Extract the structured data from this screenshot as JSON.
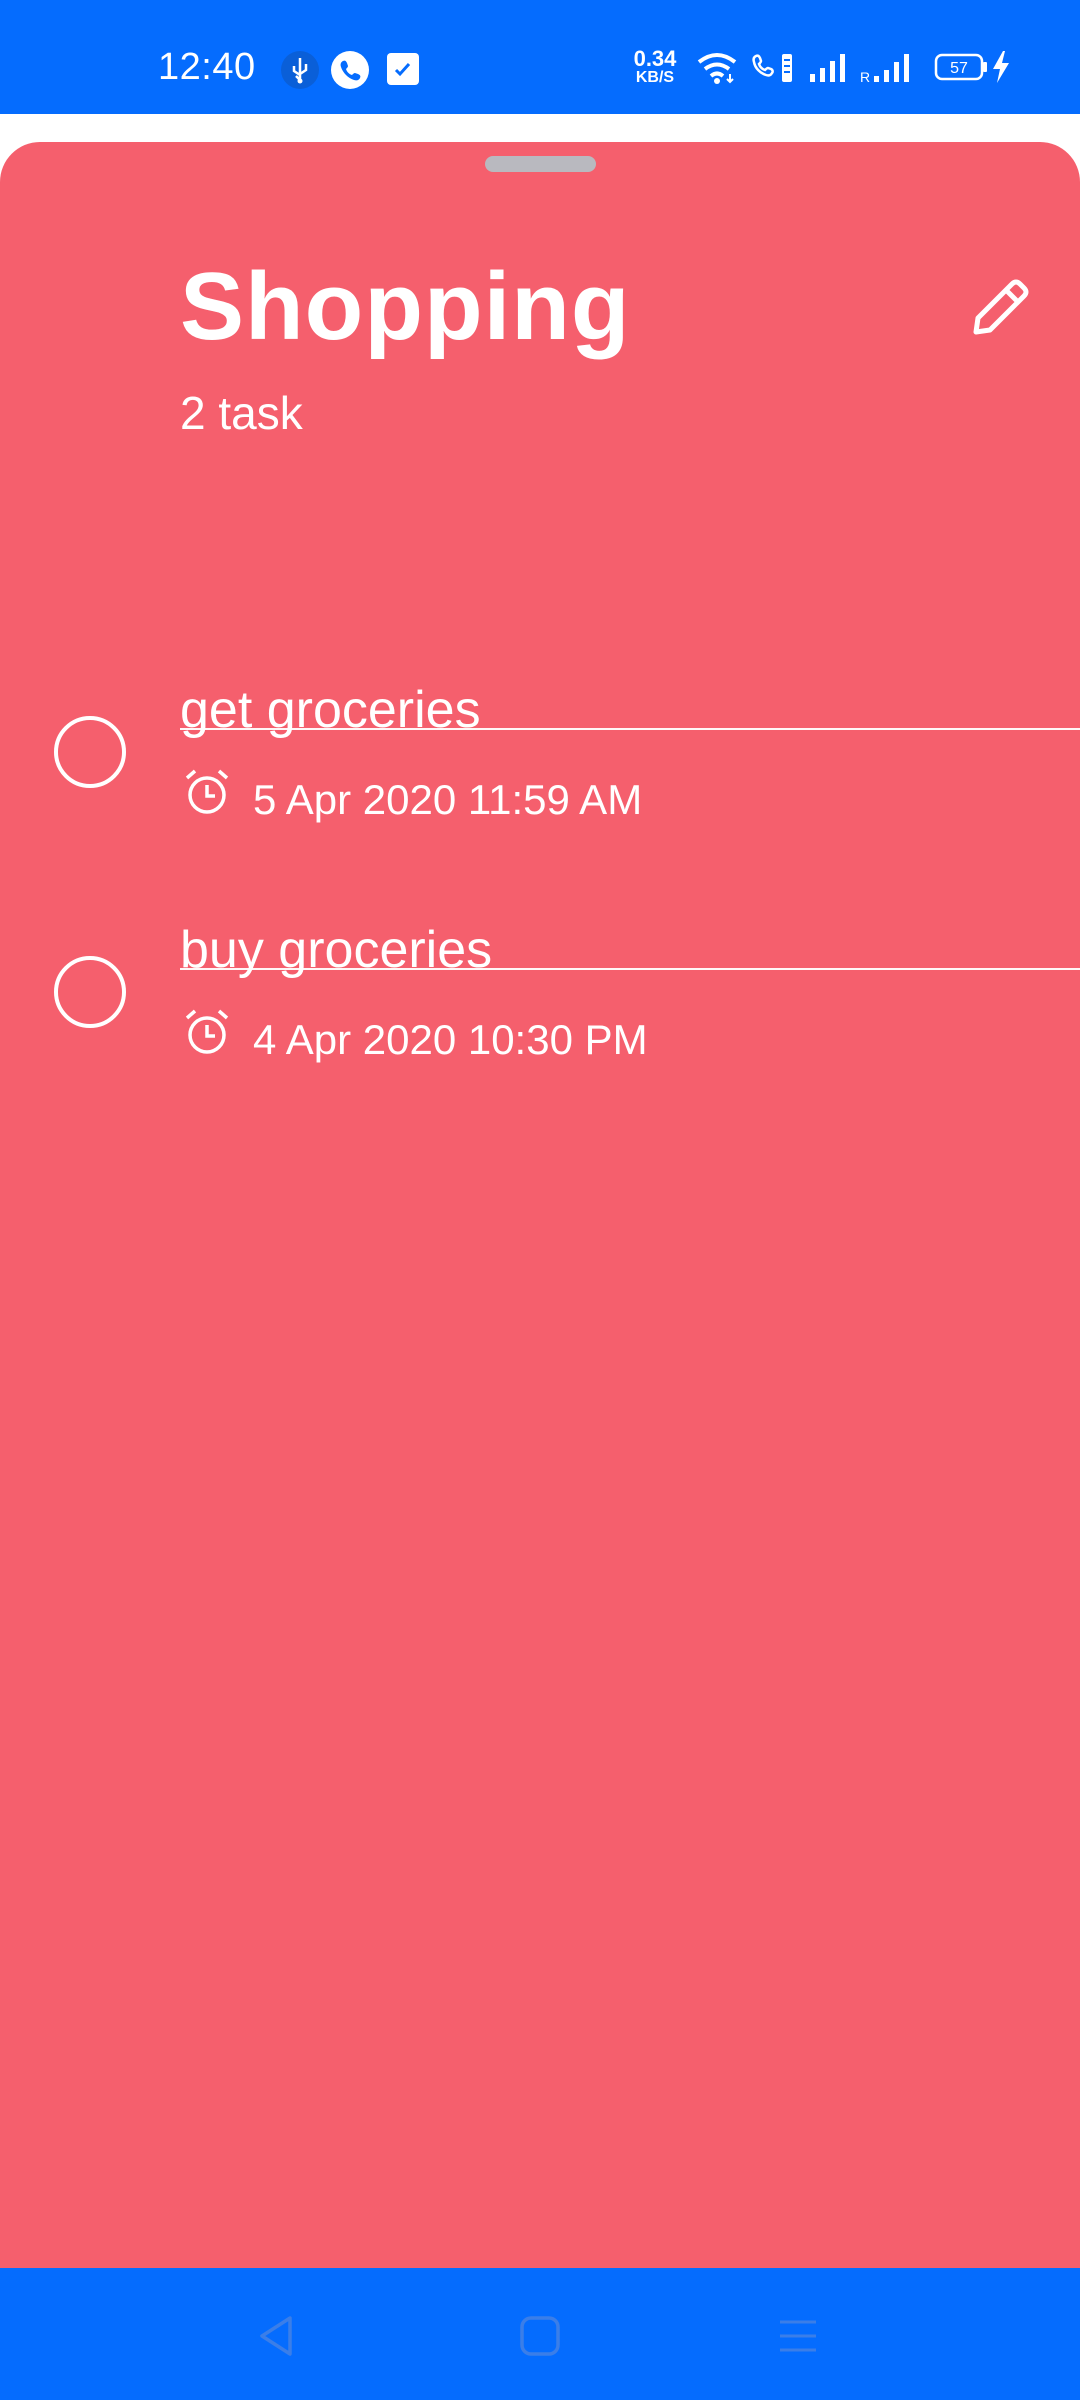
{
  "status_bar": {
    "time": "12:40",
    "net_speed_value": "0.34",
    "net_speed_unit": "KB/S",
    "battery": "57",
    "roaming": "R",
    "icons": [
      "usb-icon",
      "phone-call-icon",
      "checkbox-notification-icon",
      "wifi-icon",
      "vowifi-call-icon",
      "signal-icon",
      "signal-roaming-icon",
      "battery-icon",
      "charging-icon"
    ]
  },
  "list": {
    "title": "Shopping",
    "count_text": "2 task",
    "accent_color": "#f55f6d",
    "bar_color": "#056cfe"
  },
  "tasks": [
    {
      "title": "get groceries",
      "due": "5 Apr 2020 11:59 AM"
    },
    {
      "title": "buy groceries",
      "due": "4 Apr 2020 10:30 PM"
    }
  ],
  "nav_bar": {
    "buttons": [
      "back-icon",
      "home-icon",
      "recents-icon"
    ]
  }
}
